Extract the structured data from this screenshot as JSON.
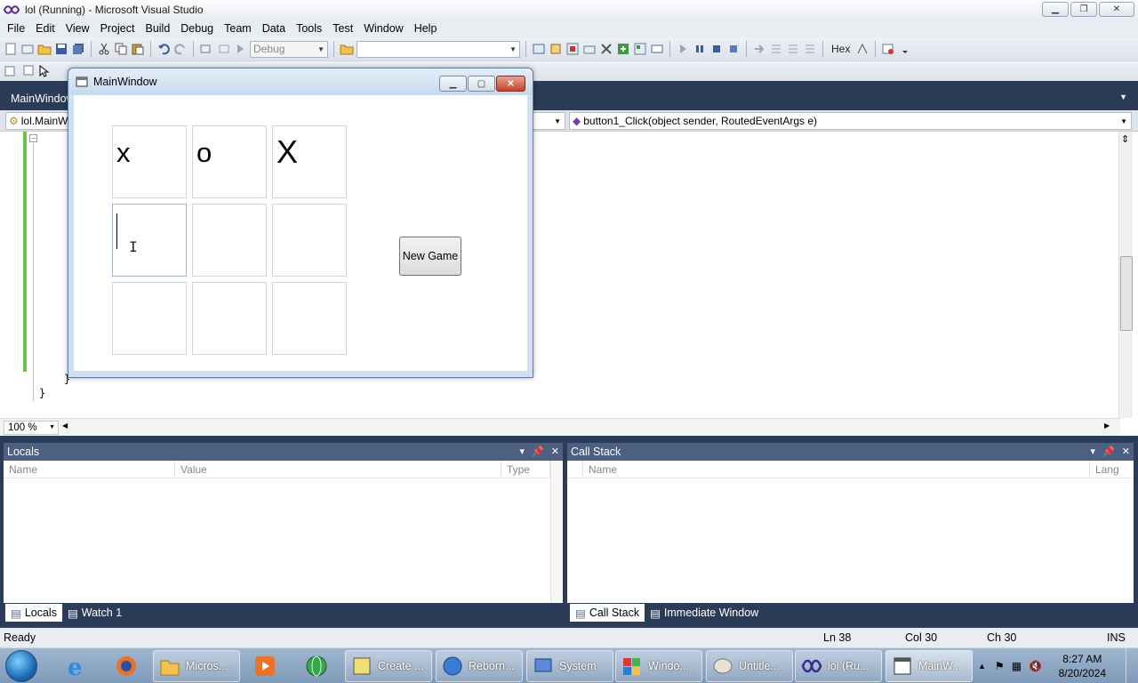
{
  "window": {
    "title": "lol (Running) - Microsoft Visual Studio",
    "controls": {
      "minimize": "▁",
      "restore": "❐",
      "close": "✕"
    }
  },
  "menu": [
    "File",
    "Edit",
    "View",
    "Project",
    "Build",
    "Debug",
    "Team",
    "Data",
    "Tools",
    "Test",
    "Window",
    "Help"
  ],
  "toolbar": {
    "config_combo": "Debug",
    "search_combo": "",
    "hex_label": "Hex"
  },
  "document": {
    "tab_label": "MainWindow",
    "nav_left": "lol.MainWi",
    "nav_right": "button1_Click(object sender, RoutedEventArgs e)",
    "code_braces": [
      "}",
      "}"
    ],
    "collapse_glyph": "−",
    "zoom": "100 %"
  },
  "locals_pane": {
    "title": "Locals",
    "columns": [
      "Name",
      "Value",
      "Type"
    ],
    "tabs": [
      "Locals",
      "Watch 1"
    ]
  },
  "callstack_pane": {
    "title": "Call Stack",
    "columns": [
      "Name",
      "Lang"
    ],
    "tabs": [
      "Call Stack",
      "Immediate Window"
    ]
  },
  "status": {
    "text": "Ready",
    "ln": "Ln 38",
    "col": "Col 30",
    "ch": "Ch 30",
    "mode": "INS"
  },
  "taskbar": {
    "tasks": [
      "Micros...",
      "Create ...",
      "Reborn...",
      "System",
      "Windo...",
      "Untitle...",
      "lol (Ru...",
      "MainW..."
    ],
    "clock_time": "8:27 AM",
    "clock_date": "8/20/2024"
  },
  "app": {
    "title": "MainWindow",
    "cells": [
      "x",
      "o",
      "X",
      "",
      "",
      "",
      "",
      "",
      ""
    ],
    "new_game_label": "New Game"
  },
  "colors": {
    "doc_background": "#2b3c58",
    "pane_title": "#4d6082",
    "margin_green": "#6cc24a"
  }
}
